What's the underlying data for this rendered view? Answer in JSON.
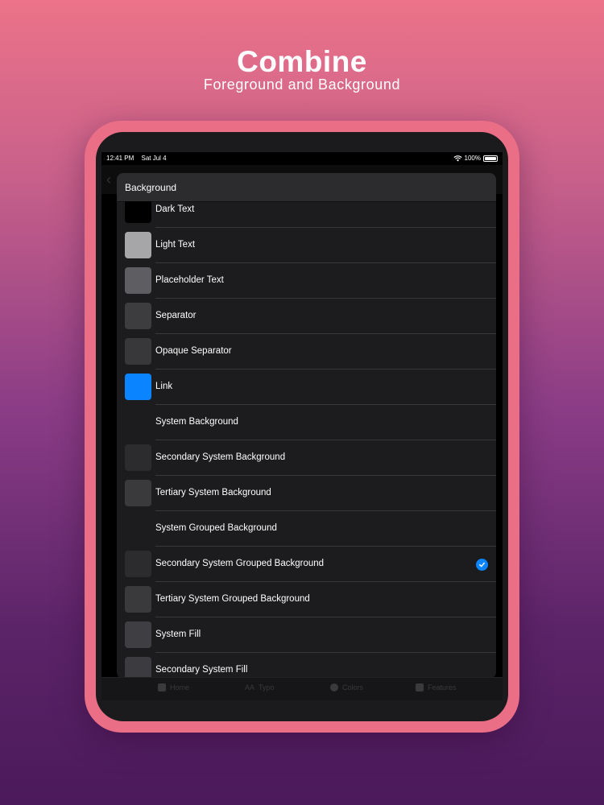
{
  "headline": {
    "title": "Combine",
    "subtitle": "Foreground and Background"
  },
  "statusbar": {
    "time": "12:41 PM",
    "date": "Sat Jul 4",
    "battery": "100%"
  },
  "sheet": {
    "title": "Background",
    "items": [
      {
        "label": "Dark Text",
        "swatch": "#000000",
        "selected": false
      },
      {
        "label": "Light Text",
        "swatch": "#a6a6a8",
        "selected": false
      },
      {
        "label": "Placeholder Text",
        "swatch": "#5d5d62",
        "selected": false
      },
      {
        "label": "Separator",
        "swatch": "#3d3d40",
        "selected": false
      },
      {
        "label": "Opaque Separator",
        "swatch": "#38383a",
        "selected": false
      },
      {
        "label": "Link",
        "swatch": "#0a84ff",
        "selected": false
      },
      {
        "label": "System Background",
        "swatch": "#1c1c1e",
        "selected": false
      },
      {
        "label": "Secondary System Background",
        "swatch": "#2c2c2e",
        "selected": false
      },
      {
        "label": "Tertiary System Background",
        "swatch": "#3a3a3c",
        "selected": false
      },
      {
        "label": "System Grouped Background",
        "swatch": "#1c1c1e",
        "selected": false
      },
      {
        "label": "Secondary System Grouped Background",
        "swatch": "#2c2c2e",
        "selected": true
      },
      {
        "label": "Tertiary System Grouped Background",
        "swatch": "#3a3a3c",
        "selected": false
      },
      {
        "label": "System Fill",
        "swatch": "#3f3f43",
        "selected": false
      },
      {
        "label": "Secondary System Fill",
        "swatch": "#3c3c40",
        "selected": false
      }
    ]
  },
  "tabbar": {
    "tabs": [
      {
        "label": "Home",
        "icon": "home-icon"
      },
      {
        "label": "Typo",
        "icon": "typography-icon"
      },
      {
        "label": "Colors",
        "icon": "colors-icon"
      },
      {
        "label": "Features",
        "icon": "features-icon"
      }
    ],
    "typo_glyph": "AA"
  },
  "colors": {
    "accent": "#0a84ff",
    "device_frame": "#ea6f86"
  }
}
